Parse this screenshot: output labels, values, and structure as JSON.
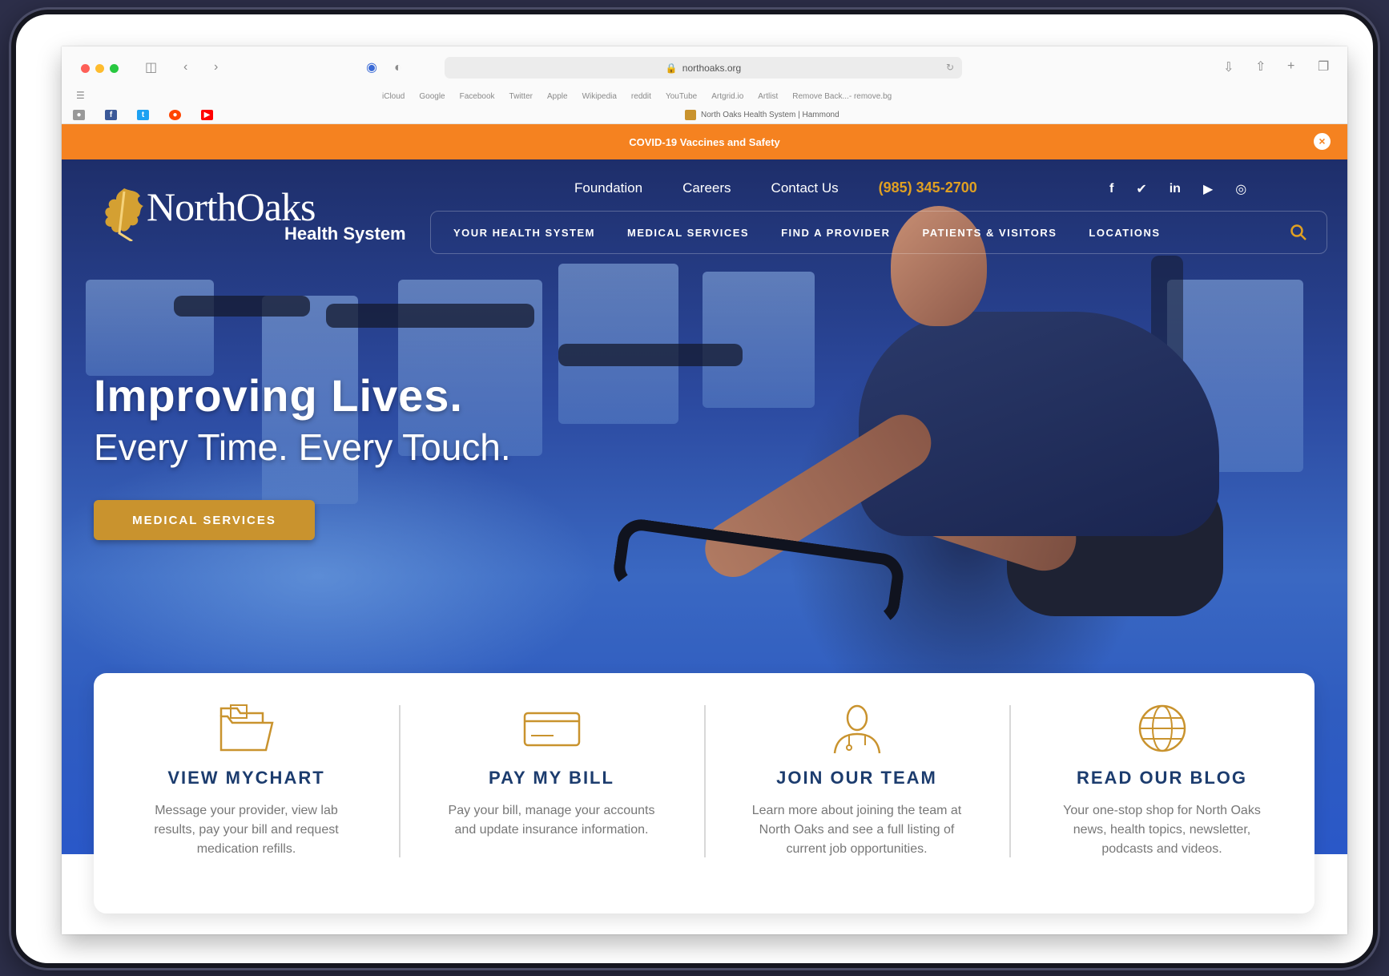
{
  "browser": {
    "url": "northoaks.org",
    "bookmarks": [
      "iCloud",
      "Google",
      "Facebook",
      "Twitter",
      "Apple",
      "Wikipedia",
      "reddit",
      "YouTube",
      "Artgrid.io",
      "Artlist",
      "Remove Back...- remove.bg"
    ],
    "tab_title": "North Oaks Health System | Hammond"
  },
  "covid_banner": {
    "text": "COVID-19 Vaccines and Safety"
  },
  "logo": {
    "name": "NorthOaks",
    "sub": "Health System"
  },
  "top_nav": {
    "links": [
      "Foundation",
      "Careers",
      "Contact Us"
    ],
    "phone": "(985) 345-2700",
    "social": [
      "f",
      "✔",
      "in",
      "▶",
      "◎"
    ]
  },
  "main_nav": [
    "YOUR HEALTH SYSTEM",
    "MEDICAL SERVICES",
    "FIND A PROVIDER",
    "PATIENTS & VISITORS",
    "LOCATIONS"
  ],
  "hero": {
    "headline": "Improving Lives.",
    "subline": "Every Time. Every Touch.",
    "cta": "MEDICAL SERVICES"
  },
  "cards": [
    {
      "icon": "folder-icon",
      "title": "VIEW MYCHART",
      "desc": "Message your provider, view lab results, pay your bill and request medication refills."
    },
    {
      "icon": "credit-card-icon",
      "title": "PAY MY BILL",
      "desc": "Pay your bill, manage your accounts and update insurance information."
    },
    {
      "icon": "doctor-icon",
      "title": "JOIN OUR TEAM",
      "desc": "Learn more about joining the team at North Oaks and see a full listing of current job opportunities."
    },
    {
      "icon": "globe-icon",
      "title": "READ OUR BLOG",
      "desc": "Your one-stop shop for North Oaks news, health topics, newsletter, podcasts and videos."
    }
  ],
  "colors": {
    "accent_orange": "#f58220",
    "gold": "#c9932e",
    "navy": "#1c3c6e"
  }
}
